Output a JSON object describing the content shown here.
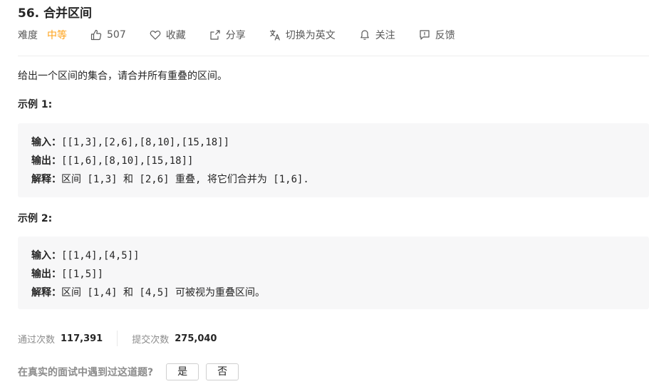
{
  "problem": {
    "title": "56. 合并区间"
  },
  "toolbar": {
    "difficulty_label": "难度",
    "difficulty_value": "中等",
    "likes_count": "507",
    "favorite_label": "收藏",
    "share_label": "分享",
    "translate_label": "切换为英文",
    "follow_label": "关注",
    "feedback_label": "反馈"
  },
  "description": "给出一个区间的集合，请合并所有重叠的区间。",
  "examples": [
    {
      "heading": "示例 1:",
      "input_label": "输入：",
      "input": "[[1,3],[2,6],[8,10],[15,18]]",
      "output_label": "输出：",
      "output": "[[1,6],[8,10],[15,18]]",
      "explain_label": "解释：",
      "explain": "区间 [1,3] 和 [2,6] 重叠, 将它们合并为 [1,6]."
    },
    {
      "heading": "示例 2:",
      "input_label": "输入：",
      "input": "[[1,4],[4,5]]",
      "output_label": "输出：",
      "output": "[[1,5]]",
      "explain_label": "解释：",
      "explain": "区间 [1,4] 和 [4,5] 可被视为重叠区间。"
    }
  ],
  "stats": {
    "accepted_label": "通过次数",
    "accepted_value": "117,391",
    "submitted_label": "提交次数",
    "submitted_value": "275,040"
  },
  "interview": {
    "question": "在真实的面试中遇到过这道题?",
    "yes_label": "是",
    "no_label": "否"
  },
  "colors": {
    "difficulty_medium": "#ffa116",
    "code_background": "#f7f7f8"
  }
}
